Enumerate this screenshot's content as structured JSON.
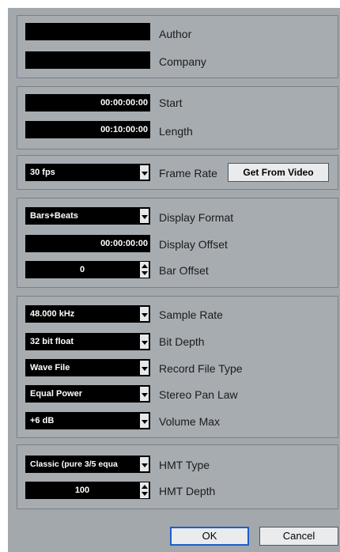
{
  "author": {
    "value": "",
    "label": "Author"
  },
  "company": {
    "value": "",
    "label": "Company"
  },
  "start": {
    "value": "00:00:00:00",
    "label": "Start"
  },
  "length": {
    "value": "00:10:00:00",
    "label": "Length"
  },
  "frame_rate": {
    "value": "30 fps",
    "label": "Frame Rate",
    "button": "Get From Video"
  },
  "display_format": {
    "value": "Bars+Beats",
    "label": "Display Format"
  },
  "display_offset": {
    "value": "00:00:00:00",
    "label": "Display Offset"
  },
  "bar_offset": {
    "value": "0",
    "label": "Bar Offset"
  },
  "sample_rate": {
    "value": "48.000 kHz",
    "label": "Sample Rate"
  },
  "bit_depth": {
    "value": "32 bit float",
    "label": "Bit Depth"
  },
  "record_file_type": {
    "value": "Wave File",
    "label": "Record File Type"
  },
  "stereo_pan_law": {
    "value": "Equal Power",
    "label": "Stereo Pan Law"
  },
  "volume_max": {
    "value": "+6 dB",
    "label": "Volume Max"
  },
  "hmt_type": {
    "value": "Classic (pure 3/5 equa",
    "label": "HMT Type"
  },
  "hmt_depth": {
    "value": "100",
    "label": "HMT Depth"
  },
  "buttons": {
    "ok": "OK",
    "cancel": "Cancel"
  },
  "colors": {
    "dialog_bg": "#a3a8ad",
    "field_bg": "#000000",
    "ok_border": "#1e5ec8"
  }
}
